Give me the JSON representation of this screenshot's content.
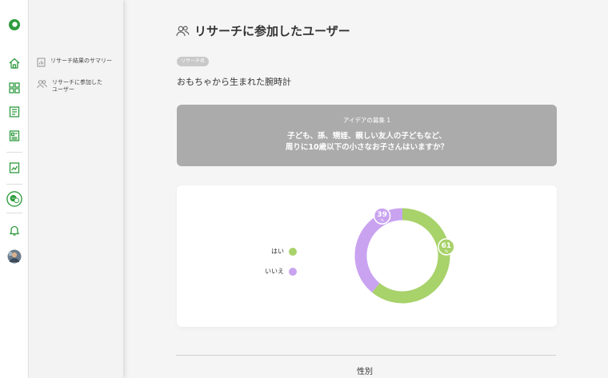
{
  "colors": {
    "brand": "#2e9b3e",
    "yes": "#a8d26a",
    "no": "#c9a3f0"
  },
  "rail": {
    "icons": [
      "logo-icon",
      "home-icon",
      "grid-icon",
      "document-icon",
      "report-icon",
      "chart-icon",
      "chat-icon",
      "bell-icon",
      "avatar"
    ]
  },
  "subnav": {
    "items": [
      {
        "label": "リサーチ結果のサマリー",
        "icon": "summary-icon"
      },
      {
        "label": "リサーチに参加したユーザー",
        "icon": "users-icon"
      }
    ]
  },
  "main": {
    "title": "リサーチに参加したユーザー",
    "tag": "リサーチ名",
    "research_name": "おもちゃから生まれた腕時計",
    "question": {
      "label": "アイデアの募集 1",
      "line1": "子ども、孫、甥姪、親しい友人の子どもなど、",
      "line2": "周りに10歳以下の小さなお子さんはいますか？"
    },
    "section_title": "性別"
  },
  "chart_data": {
    "type": "pie",
    "categories": [
      "はい",
      "いいえ"
    ],
    "values": [
      61,
      39
    ],
    "unit": "%",
    "legend": "left"
  }
}
